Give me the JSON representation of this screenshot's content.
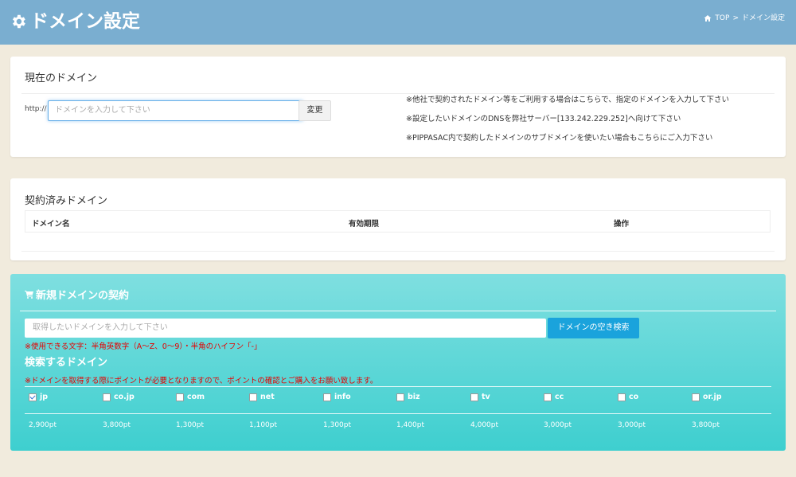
{
  "header": {
    "title": "ドメイン設定",
    "breadcrumb": [
      "TOP",
      ">",
      "ドメイン設定"
    ]
  },
  "current_domain": {
    "title": "現在のドメイン",
    "prefix": "http://",
    "input_placeholder": "ドメインを入力して下さい",
    "change_button": "変更",
    "notes": [
      "※他社で契約されたドメイン等をご利用する場合はこちらで、指定のドメインを入力して下さい",
      "※設定したいドメインのDNSを弊社サーバー[133.242.229.252]へ向けて下さい",
      "※PIPPASAC内で契約したドメインのサブドメインを使いたい場合もこちらにご入力下さい"
    ]
  },
  "contracted": {
    "title": "契約済みドメイン",
    "columns": [
      "ドメイン名",
      "有効期限",
      "操作"
    ]
  },
  "new_domain": {
    "title": "新規ドメインの契約",
    "search_placeholder": "取得したいドメインを入力して下さい",
    "search_button": "ドメインの空き検索",
    "allowed_chars_note": "※使用できる文字：半角英数字（A〜Z、0〜9）・半角のハイフン「-」",
    "search_domains_title": "検索するドメイン",
    "points_note": "※ドメインを取得する際にポイントが必要となりますので、ポイントの確認とご購入をお願い致します。",
    "tlds": [
      {
        "name": "jp",
        "checked": true
      },
      {
        "name": "co.jp",
        "checked": false
      },
      {
        "name": "com",
        "checked": false
      },
      {
        "name": "net",
        "checked": false
      },
      {
        "name": "info",
        "checked": false
      },
      {
        "name": "biz",
        "checked": false
      },
      {
        "name": "tv",
        "checked": false
      },
      {
        "name": "cc",
        "checked": false
      },
      {
        "name": "co",
        "checked": false
      },
      {
        "name": "or.jp",
        "checked": false
      }
    ],
    "prices": [
      "2,900pt",
      "3,800pt",
      "1,300pt",
      "1,100pt",
      "1,300pt",
      "1,400pt",
      "4,000pt",
      "3,000pt",
      "3,000pt",
      "3,800pt"
    ]
  },
  "colors": {
    "header": "#7aaed0",
    "panel_top": "#7fdfe0",
    "panel_bottom": "#3ecfcf",
    "search_button": "#1aa3dc",
    "warning": "#e60000"
  },
  "icons": [
    "gear-icon",
    "home-icon",
    "cart-icon",
    "checkbox-icon"
  ]
}
